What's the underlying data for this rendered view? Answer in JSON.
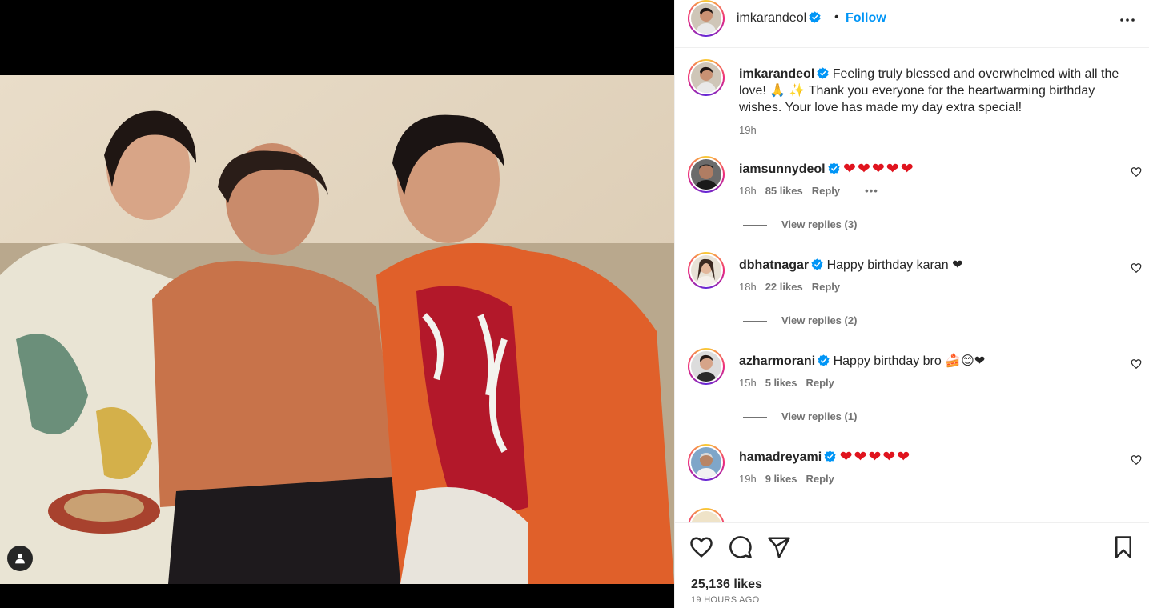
{
  "post": {
    "username": "imkarandeol",
    "follow_label": "Follow",
    "separator": "•"
  },
  "caption": {
    "username": "imkarandeol",
    "text": "Feeling truly blessed and overwhelmed with all the love! 🙏 ✨ Thank you everyone for the heartwarming birthday wishes. Your love has made my day extra special!",
    "time": "19h"
  },
  "comments": [
    {
      "username": "iamsunnydeol",
      "text": "❤❤❤❤❤",
      "time": "18h",
      "likes": "85 likes",
      "reply": "Reply",
      "more": "•••",
      "view_replies": "View replies (3)"
    },
    {
      "username": "dbhatnagar",
      "text": "Happy birthday karan ❤",
      "time": "18h",
      "likes": "22 likes",
      "reply": "Reply",
      "view_replies": "View replies (2)"
    },
    {
      "username": "azharmorani",
      "text": "Happy birthday bro 🍰😊❤",
      "time": "15h",
      "likes": "5 likes",
      "reply": "Reply",
      "view_replies": "View replies (1)"
    },
    {
      "username": "hamadreyami",
      "text": "❤❤❤❤❤",
      "time": "19h",
      "likes": "9 likes",
      "reply": "Reply"
    }
  ],
  "footer": {
    "likes": "25,136 likes",
    "time_ago": "19 HOURS AGO"
  },
  "colors": {
    "accent": "#0095f6",
    "heart": "#e0141e",
    "verified": "#0095f6",
    "muted": "#737373"
  },
  "icons": [
    "user-tag-icon",
    "more-options-icon",
    "verified-icon",
    "like-heart-icon",
    "comment-icon",
    "share-icon",
    "save-bookmark-icon"
  ]
}
